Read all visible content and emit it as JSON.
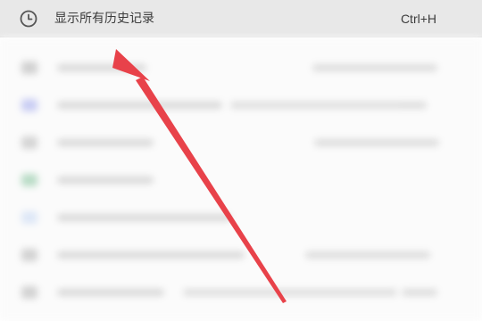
{
  "menu": {
    "show_all_history_label": "显示所有历史记录",
    "shortcut": "Ctrl+H",
    "icon": "clock-icon"
  },
  "annotation": {
    "arrow_color": "#e8424a"
  },
  "colors": {
    "menu_bg": "#e8e8e8",
    "text": "#3c3c3c"
  }
}
